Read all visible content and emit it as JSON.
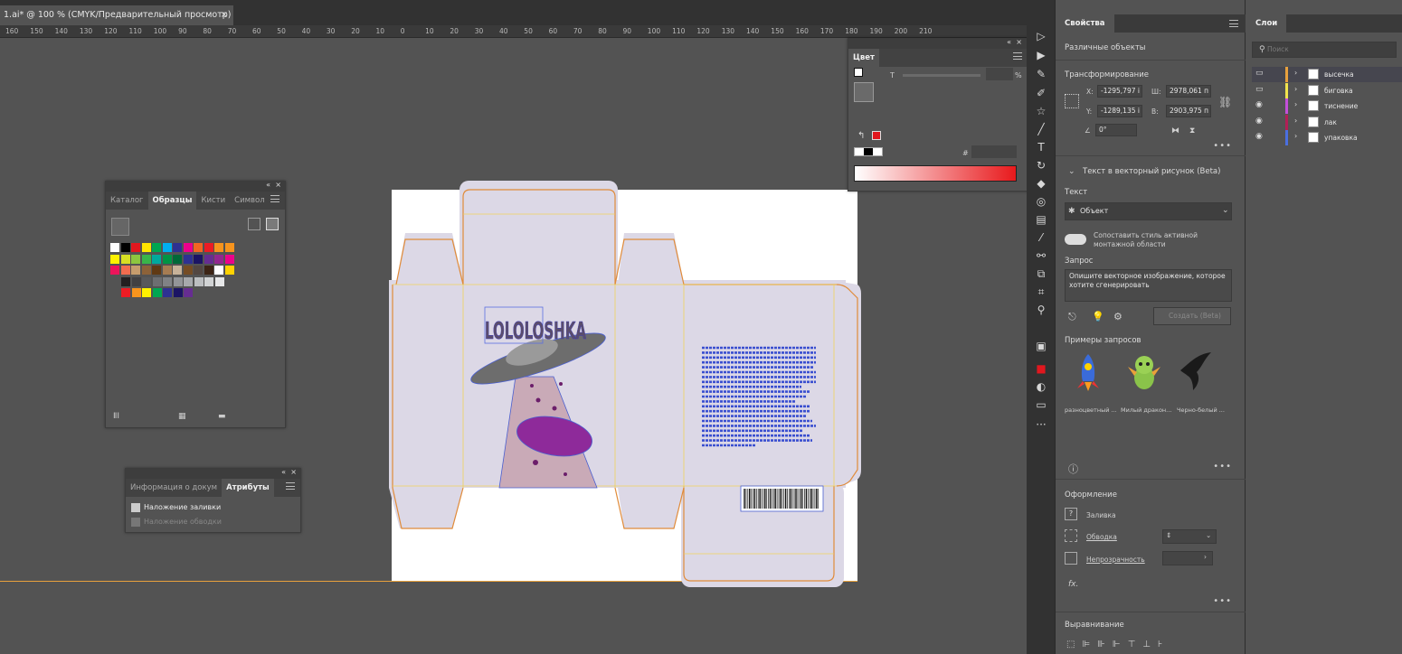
{
  "document": {
    "tab_title": "1.ai* @ 100 % (CMYK/Предварительный просмотр)",
    "close_glyph": "×"
  },
  "ruler": {
    "labels": [
      "160",
      "150",
      "140",
      "130",
      "120",
      "110",
      "100",
      "90",
      "80",
      "70",
      "60",
      "50",
      "40",
      "30",
      "20",
      "10",
      "0",
      "10",
      "20",
      "30",
      "40",
      "50",
      "60",
      "70",
      "80",
      "90",
      "100",
      "110",
      "120",
      "130",
      "140",
      "150",
      "160",
      "170",
      "180",
      "190",
      "200",
      "210"
    ]
  },
  "artboard": {
    "brand_text": "LOLOLOSHKA",
    "body_text_color": "#3a4fd0",
    "background": "#ffffff",
    "box_fill": "#dcd8e6",
    "dieline_color": "#e08b3a",
    "fold_color": "#f0d25a",
    "ellipse_color": "#8e2a9a"
  },
  "swatches_panel": {
    "tabs": [
      "Каталог",
      "Образцы",
      "Кисти",
      "Символ"
    ],
    "active_tab": "Образцы",
    "row1": [
      "#ffffff",
      "#000000",
      "#e1171e",
      "#ffe600",
      "#00a651",
      "#00aeef",
      "#2e3192",
      "#ec008c",
      "#f26522",
      "#ed1c24",
      "#f7941d",
      "#f7941d"
    ],
    "row2": [
      "#fff200",
      "#d7df23",
      "#8dc63f",
      "#39b54a",
      "#00a99d",
      "#009444",
      "#006838",
      "#2e3192",
      "#1b1464",
      "#662d91",
      "#92278f",
      "#ec008c"
    ],
    "row3": [
      "#ed145b",
      "#f26c4f",
      "#c69c6d",
      "#8c6239",
      "#603913",
      "#a67c52",
      "#c7b299",
      "#754c24",
      "#534741",
      "#3c2415",
      "#ffffff",
      "#ffd200"
    ],
    "row4_grays": [
      "#231f20",
      "#414042",
      "#58595b",
      "#6d6e71",
      "#808285",
      "#939598",
      "#a7a9ac",
      "#bcbec0",
      "#d1d3d4",
      "#e6e7e8"
    ],
    "row5": [
      "#ed1c24",
      "#f7941d",
      "#fff200",
      "#00a651",
      "#2e3192",
      "#1b1464",
      "#662d91"
    ]
  },
  "info_panel": {
    "tabs": [
      "Информация о докум",
      "Атрибуты"
    ],
    "active_tab": "Атрибуты",
    "overprint_fill": "Наложение заливки",
    "overprint_stroke": "Наложение обводки"
  },
  "color_panel": {
    "title": "Цвет",
    "tint_label": "T",
    "percent_label": "%",
    "hash_label": "#",
    "fill_color": "#e1171e",
    "gradient_start": "#ffffff",
    "gradient_end": "#e8191c"
  },
  "properties": {
    "tab_title": "Свойства",
    "selection_label": "Различные объекты",
    "transform_title": "Трансформирование",
    "x_label": "X:",
    "x_value": "-1295,797 i",
    "y_label": "Y:",
    "y_value": "-1289,135 i",
    "w_label": "Ш:",
    "w_value": "2978,061 п",
    "h_label": "В:",
    "h_value": "2903,975 п",
    "angle_value": "0°",
    "text_to_vector_title": "Текст в векторный рисунок (Beta)",
    "text_label": "Текст",
    "object_dropdown": "Объект",
    "match_style_label": "Сопоставить стиль активной монтажной области",
    "prompt_label": "Запрос",
    "prompt_placeholder": "Опишите векторное изображение, которое хотите сгенерировать",
    "generate_button": "Создать (Beta)",
    "examples_title": "Примеры запросов",
    "examples": [
      "разноцветный ...",
      "Милый дракон...",
      "Черно-белый ..."
    ],
    "appearance_title": "Оформление",
    "fill_label": "Заливка",
    "stroke_label": "Обводка",
    "opacity_label": "Непрозрачность",
    "fx_label": "fx.",
    "align_title": "Выравнивание"
  },
  "layers": {
    "tab_title": "Слои",
    "search_placeholder": "Поиск",
    "items": [
      {
        "name": "высечка",
        "color": "#e8a13d"
      },
      {
        "name": "биговка",
        "color": "#f2e44c"
      },
      {
        "name": "тиснение",
        "color": "#c44fd9"
      },
      {
        "name": "лак",
        "color": "#b21f56"
      },
      {
        "name": "упаковка",
        "color": "#4a6fe0"
      }
    ]
  }
}
